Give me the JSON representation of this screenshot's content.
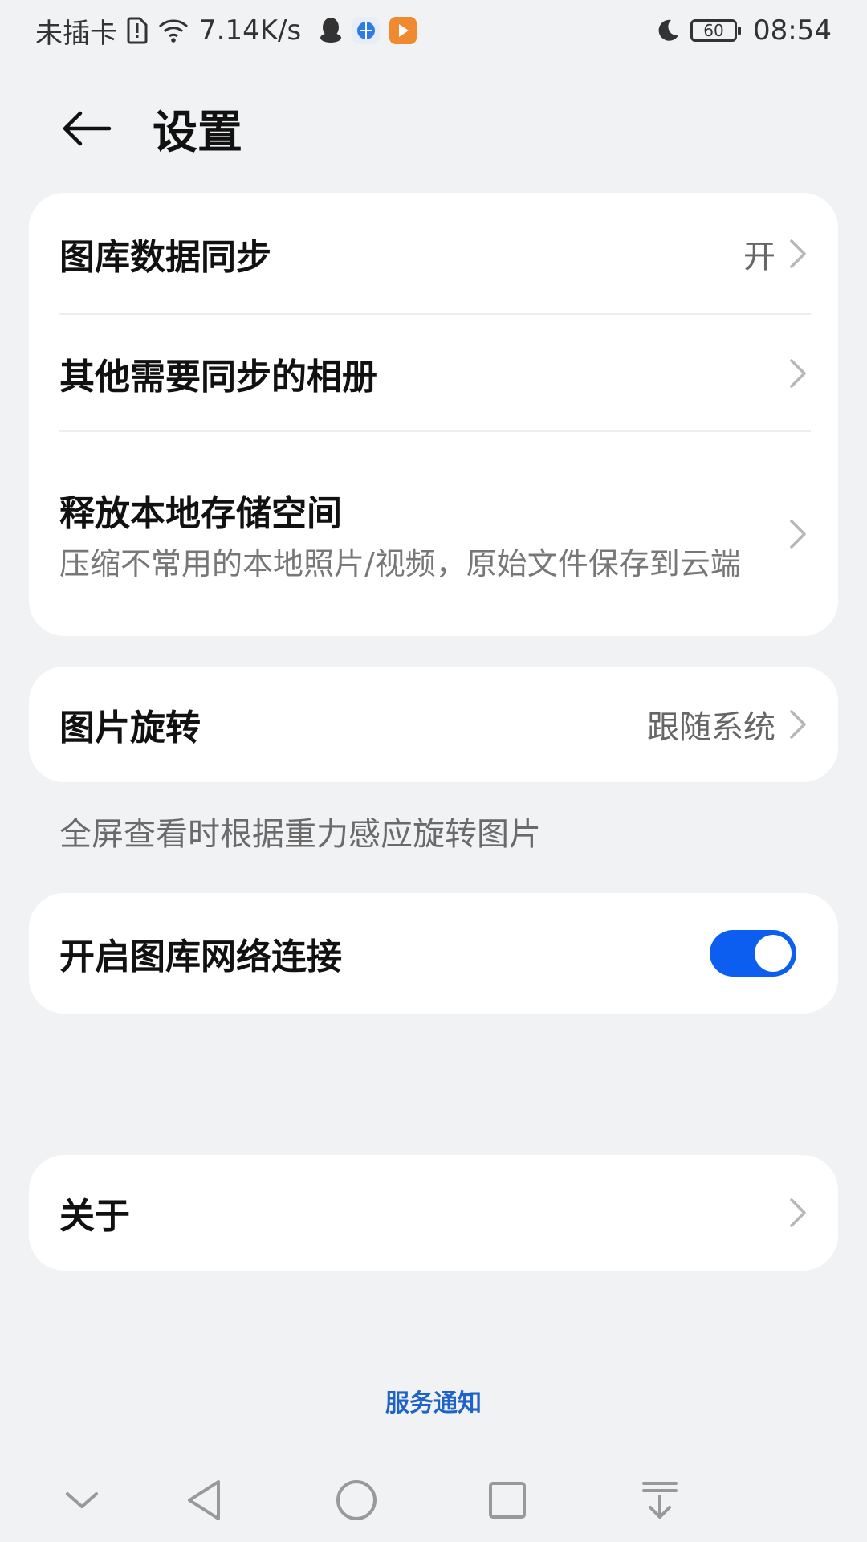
{
  "status_bar": {
    "carrier": "未插卡",
    "net_speed": "7.14K/s",
    "battery_level": "60",
    "time": "08:54"
  },
  "header": {
    "title": "设置"
  },
  "sync_card": {
    "gallery_sync": {
      "label": "图库数据同步",
      "value": "开"
    },
    "other_albums": {
      "label": "其他需要同步的相册"
    },
    "free_space": {
      "label": "释放本地存储空间",
      "description": "压缩不常用的本地照片/视频，原始文件保存到云端"
    }
  },
  "rotation_card": {
    "label": "图片旋转",
    "value": "跟随系统",
    "caption": "全屏查看时根据重力感应旋转图片"
  },
  "network_card": {
    "label": "开启图库网络连接",
    "enabled": true
  },
  "about_card": {
    "label": "关于"
  },
  "footer": {
    "service_notice": "服务通知"
  },
  "colors": {
    "accent": "#0b5ef0",
    "link": "#1f63c9",
    "background": "#f1f2f4"
  }
}
